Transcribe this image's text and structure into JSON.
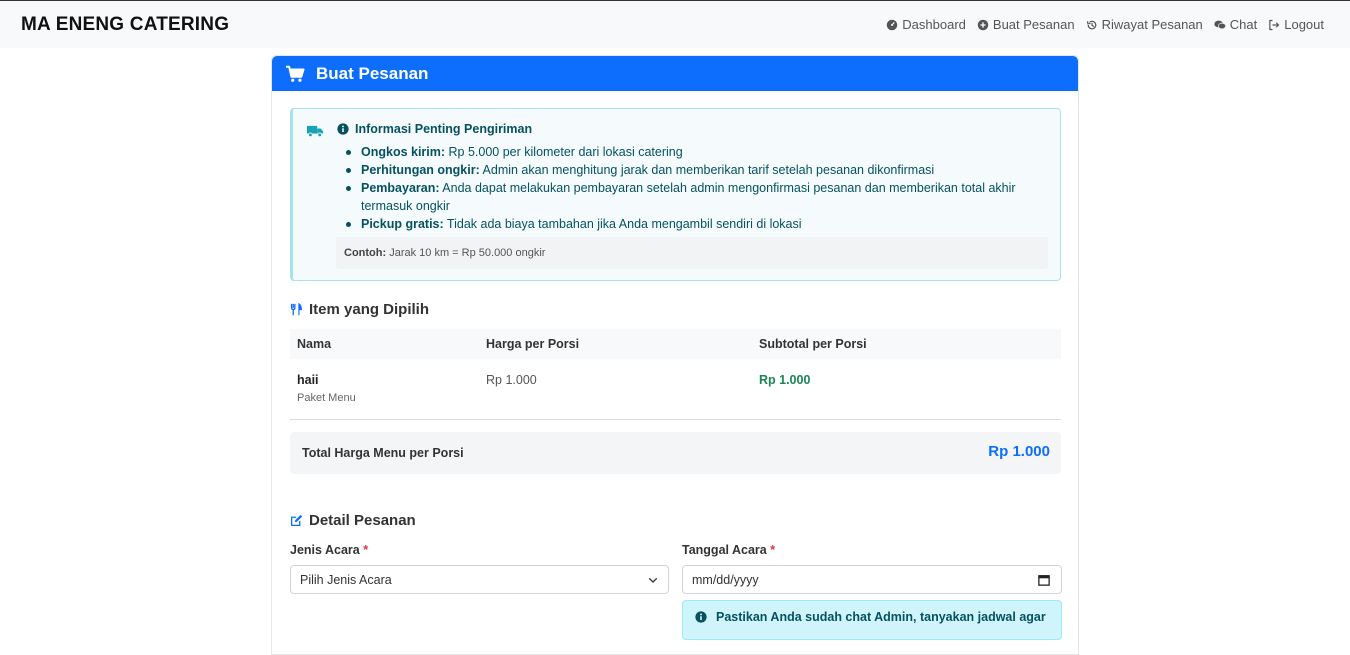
{
  "brand": "MA ENENG CATERING",
  "nav": [
    {
      "label": "Dashboard",
      "icon": "gauge-icon"
    },
    {
      "label": "Buat Pesanan",
      "icon": "plus-circle-icon"
    },
    {
      "label": "Riwayat Pesanan",
      "icon": "history-icon"
    },
    {
      "label": "Chat",
      "icon": "chat-icon"
    },
    {
      "label": "Logout",
      "icon": "logout-icon"
    }
  ],
  "card": {
    "title": "Buat Pesanan",
    "icon": "cart-icon"
  },
  "info": {
    "title": "Informasi Penting Pengiriman",
    "items": [
      {
        "bold": "Ongkos kirim:",
        "text": " Rp 5.000 per kilometer dari lokasi catering"
      },
      {
        "bold": "Perhitungan ongkir:",
        "text": " Admin akan menghitung jarak dan memberikan tarif setelah pesanan dikonfirmasi"
      },
      {
        "bold": "Pembayaran:",
        "text": " Anda dapat melakukan pembayaran setelah admin mengonfirmasi pesanan dan memberikan total akhir termasuk ongkir"
      },
      {
        "bold": "Pickup gratis:",
        "text": " Tidak ada biaya tambahan jika Anda mengambil sendiri di lokasi"
      }
    ],
    "example_bold": "Contoh:",
    "example_text": " Jarak 10 km = Rp 50.000 ongkir"
  },
  "items_section": {
    "title": "Item yang Dipilih",
    "headers": [
      "Nama",
      "Harga per Porsi",
      "Subtotal per Porsi"
    ],
    "rows": [
      {
        "name": "haii",
        "type": "Paket Menu",
        "price": "Rp 1.000",
        "subtotal": "Rp 1.000"
      }
    ],
    "total_label": "Total Harga Menu per Porsi",
    "total_value": "Rp 1.000"
  },
  "detail_section": {
    "title": "Detail Pesanan",
    "event_type_label": "Jenis Acara",
    "event_type_value": "Pilih Jenis Acara",
    "event_date_label": "Tanggal Acara",
    "event_date_placeholder": "mm/dd/yyyy",
    "required_mark": "*",
    "date_note": "Pastikan Anda sudah chat Admin, tanyakan jadwal agar"
  },
  "colors": {
    "primary": "#0d6efd",
    "info_text": "#055160",
    "success": "#198754",
    "danger": "#dc3545"
  }
}
